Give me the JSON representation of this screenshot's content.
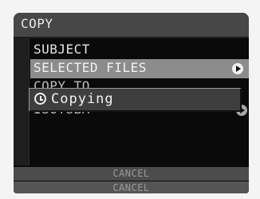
{
  "title": "COPY",
  "menu": {
    "subject_label": "SUBJECT",
    "subject_value": "SELECTED FILES",
    "copy_to_label": "COPY TO",
    "copy_to_value": "ISOYSBM"
  },
  "popup": {
    "icon": "clock-icon",
    "text": "Copying"
  },
  "buttons": {
    "cancel_1": "CANCEL",
    "cancel_2": "CANCEL"
  }
}
